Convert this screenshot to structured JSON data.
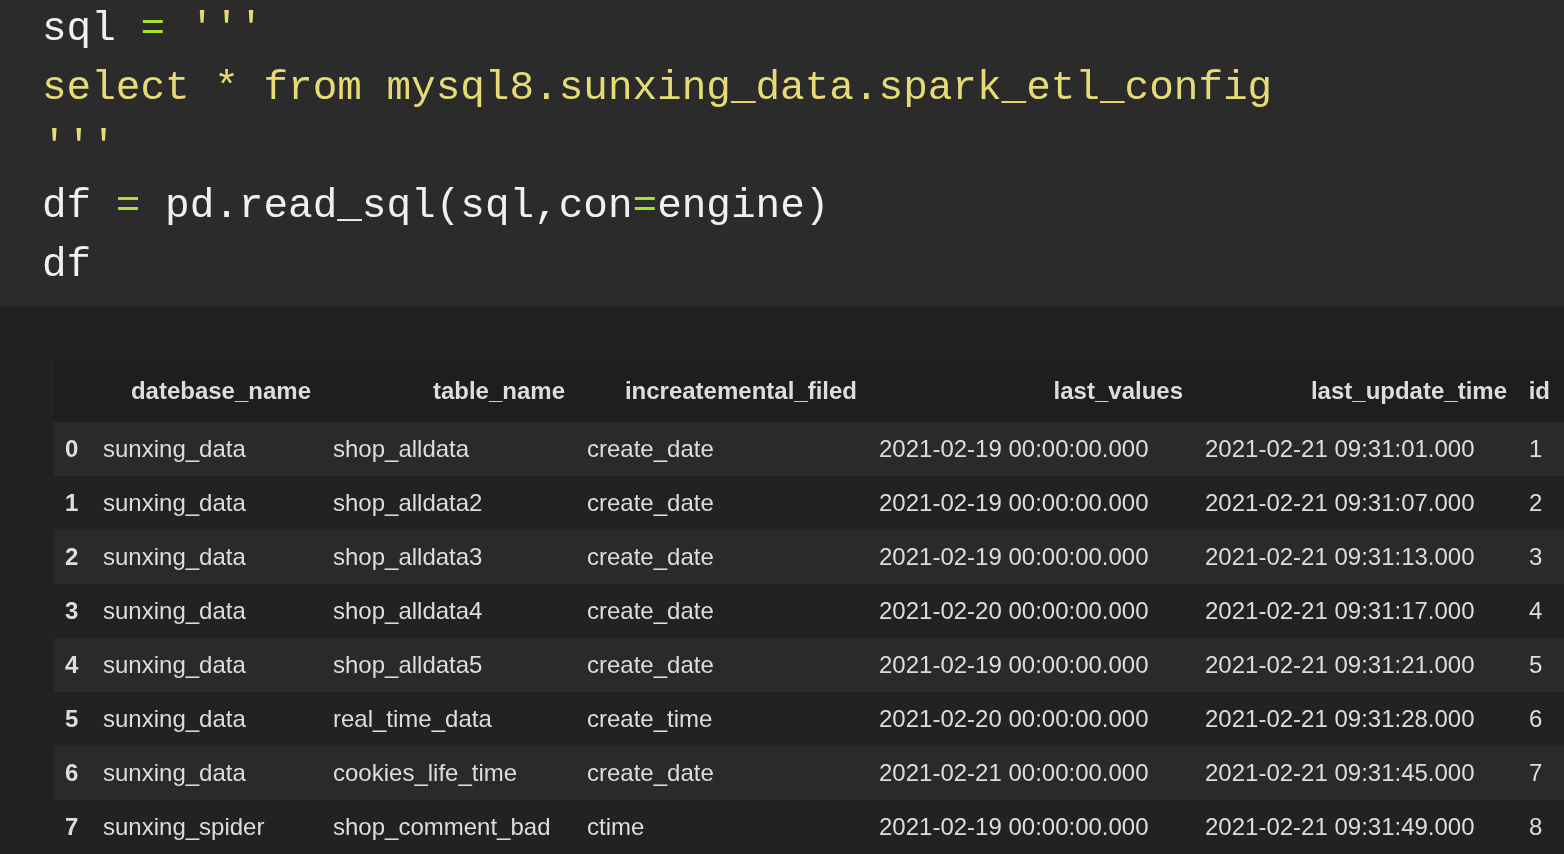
{
  "code_lines": [
    [
      {
        "text": "sql ",
        "kind": "plain"
      },
      {
        "text": "=",
        "kind": "op"
      },
      {
        "text": " '''",
        "kind": "string"
      }
    ],
    [
      {
        "text": "select * from mysql8.sunxing_data.spark_etl_config",
        "kind": "string"
      }
    ],
    [
      {
        "text": "'''",
        "kind": "string"
      }
    ],
    [
      {
        "text": "df ",
        "kind": "plain"
      },
      {
        "text": "=",
        "kind": "op"
      },
      {
        "text": " pd.read_sql(sql,con",
        "kind": "plain"
      },
      {
        "text": "=",
        "kind": "op"
      },
      {
        "text": "engine)",
        "kind": "plain"
      }
    ],
    [
      {
        "text": "df",
        "kind": "plain"
      }
    ]
  ],
  "table": {
    "columns": [
      "datebase_name",
      "table_name",
      "increatemental_filed",
      "last_values",
      "last_update_time",
      "id"
    ],
    "rows": [
      {
        "index": "0",
        "cells": [
          "sunxing_data",
          "shop_alldata",
          "create_date",
          "2021-02-19 00:00:00.000",
          "2021-02-21 09:31:01.000",
          "1"
        ]
      },
      {
        "index": "1",
        "cells": [
          "sunxing_data",
          "shop_alldata2",
          "create_date",
          "2021-02-19 00:00:00.000",
          "2021-02-21 09:31:07.000",
          "2"
        ]
      },
      {
        "index": "2",
        "cells": [
          "sunxing_data",
          "shop_alldata3",
          "create_date",
          "2021-02-19 00:00:00.000",
          "2021-02-21 09:31:13.000",
          "3"
        ]
      },
      {
        "index": "3",
        "cells": [
          "sunxing_data",
          "shop_alldata4",
          "create_date",
          "2021-02-20 00:00:00.000",
          "2021-02-21 09:31:17.000",
          "4"
        ]
      },
      {
        "index": "4",
        "cells": [
          "sunxing_data",
          "shop_alldata5",
          "create_date",
          "2021-02-19 00:00:00.000",
          "2021-02-21 09:31:21.000",
          "5"
        ]
      },
      {
        "index": "5",
        "cells": [
          "sunxing_data",
          "real_time_data",
          "create_time",
          "2021-02-20 00:00:00.000",
          "2021-02-21 09:31:28.000",
          "6"
        ]
      },
      {
        "index": "6",
        "cells": [
          "sunxing_data",
          "cookies_life_time",
          "create_date",
          "2021-02-21 00:00:00.000",
          "2021-02-21 09:31:45.000",
          "7"
        ]
      },
      {
        "index": "7",
        "cells": [
          "sunxing_spider",
          "shop_comment_bad",
          "ctime",
          "2021-02-19 00:00:00.000",
          "2021-02-21 09:31:49.000",
          "8"
        ]
      }
    ]
  }
}
